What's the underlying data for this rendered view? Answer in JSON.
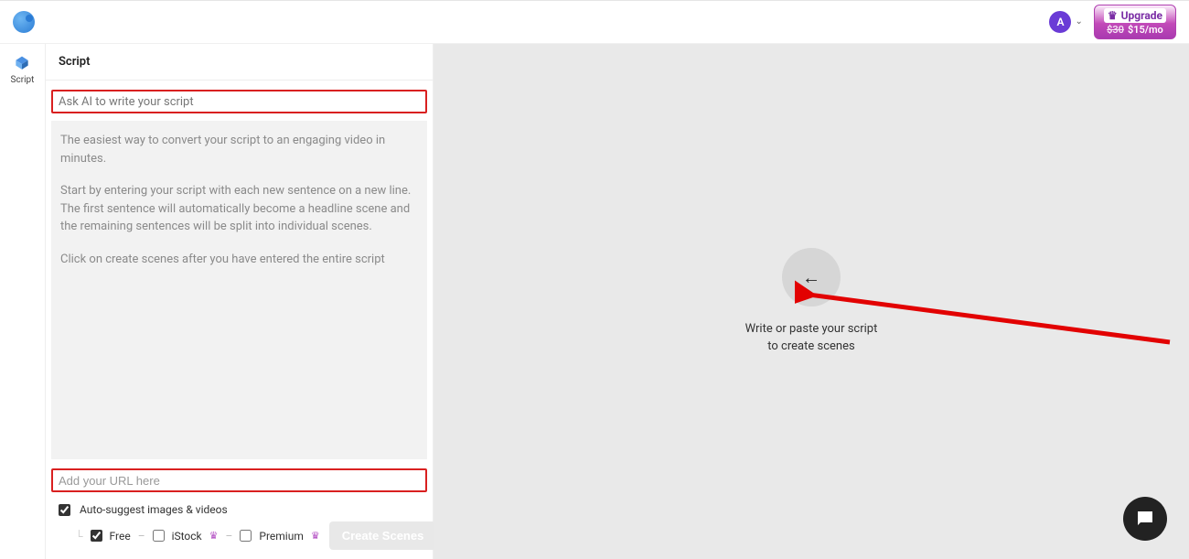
{
  "header": {
    "avatar_letter": "A",
    "upgrade_label": "Upgrade",
    "upgrade_strike": "$30",
    "upgrade_price": "$15/mo"
  },
  "rail": {
    "script_label": "Script"
  },
  "panel": {
    "title": "Script",
    "ask_ai_text": "Ask AI to write your script",
    "placeholder_p1": "The easiest way to convert your script to an engaging video in minutes.",
    "placeholder_p2": "Start by entering your script with each new sentence on a new line. The first sentence will automatically become a headline scene and the remaining sentences will be split into individual scenes.",
    "placeholder_p3": "Click on create scenes after you have entered the entire script",
    "url_placeholder": "Add your URL here",
    "auto_suggest_label": "Auto-suggest images & videos",
    "opt_free": "Free",
    "opt_istock": "iStock",
    "opt_premium": "Premium",
    "create_btn": "Create Scenes"
  },
  "stage": {
    "line1": "Write or paste your script",
    "line2": "to create scenes"
  }
}
